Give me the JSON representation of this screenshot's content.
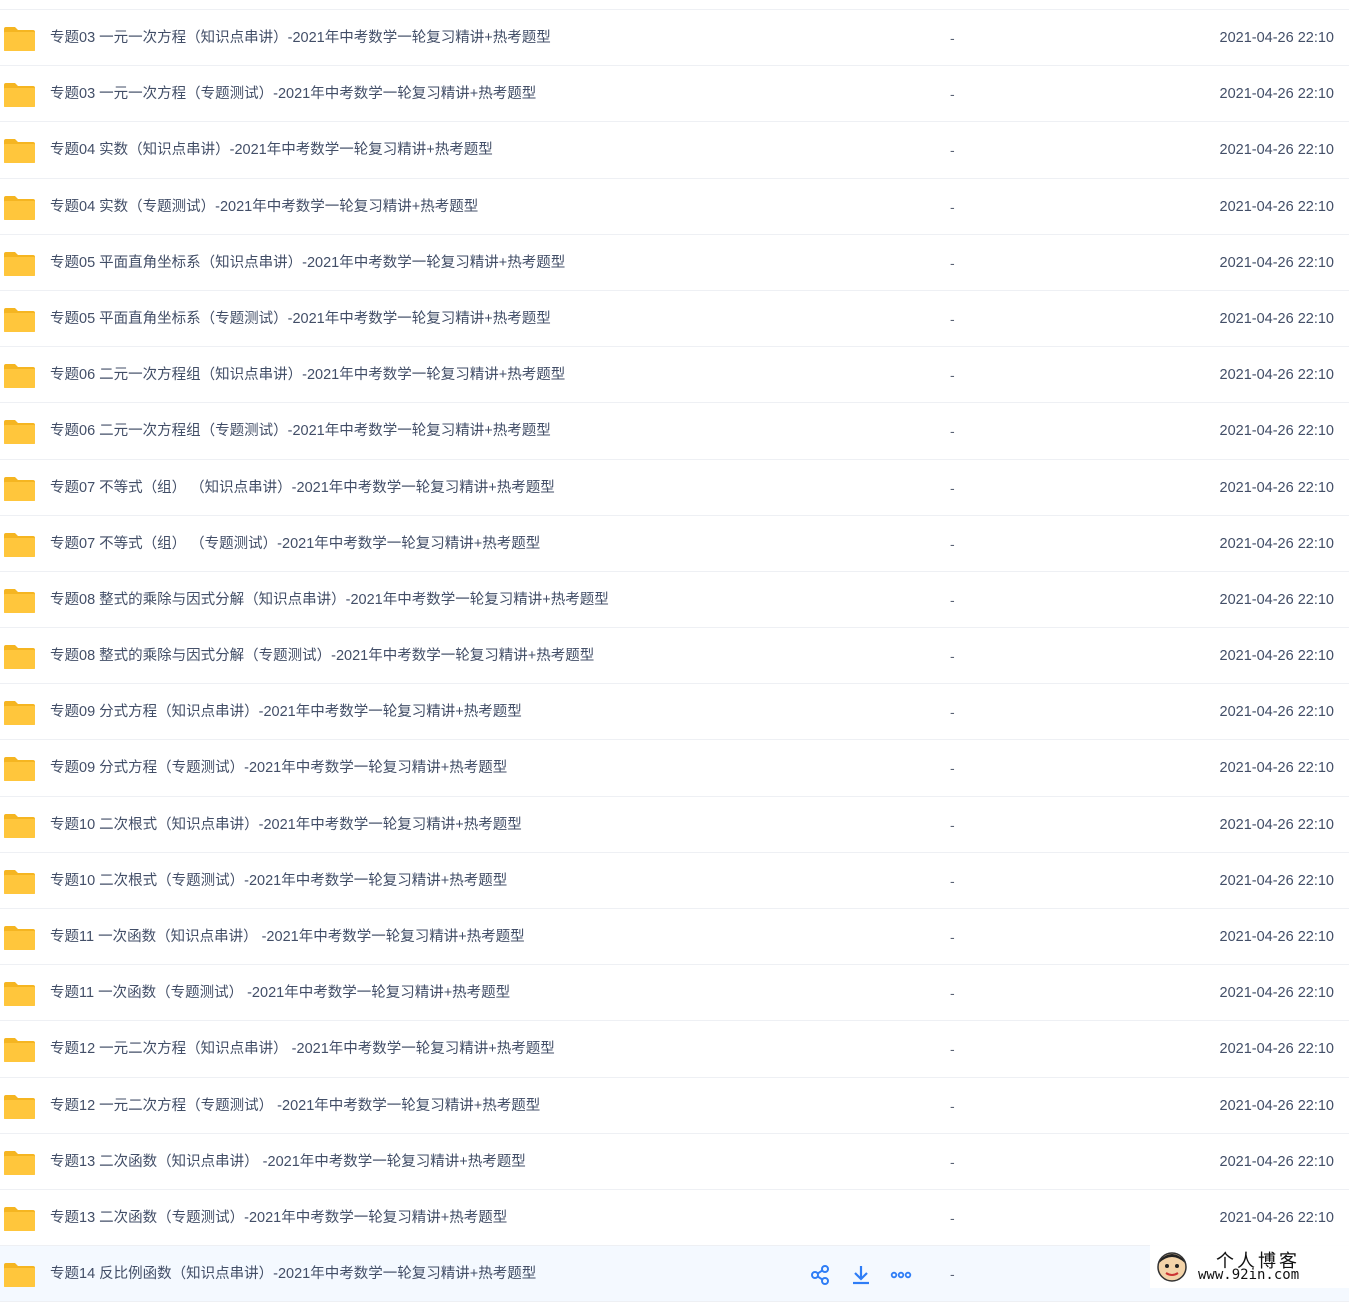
{
  "colors": {
    "folder": "#ffc63c",
    "folder_dark": "#f5b521",
    "action_blue": "#2e7df6",
    "text": "#424e67"
  },
  "file_list": {
    "rows": [
      {
        "name": "专题03 一元一次方程（知识点串讲）-2021年中考数学一轮复习精讲+热考题型",
        "size": "-",
        "date": "2021-04-26 22:10"
      },
      {
        "name": "专题03 一元一次方程（专题测试）-2021年中考数学一轮复习精讲+热考题型",
        "size": "-",
        "date": "2021-04-26 22:10"
      },
      {
        "name": "专题04 实数（知识点串讲）-2021年中考数学一轮复习精讲+热考题型",
        "size": "-",
        "date": "2021-04-26 22:10"
      },
      {
        "name": "专题04 实数（专题测试）-2021年中考数学一轮复习精讲+热考题型",
        "size": "-",
        "date": "2021-04-26 22:10"
      },
      {
        "name": "专题05 平面直角坐标系（知识点串讲）-2021年中考数学一轮复习精讲+热考题型",
        "size": "-",
        "date": "2021-04-26 22:10"
      },
      {
        "name": "专题05 平面直角坐标系（专题测试）-2021年中考数学一轮复习精讲+热考题型",
        "size": "-",
        "date": "2021-04-26 22:10"
      },
      {
        "name": "专题06 二元一次方程组（知识点串讲）-2021年中考数学一轮复习精讲+热考题型",
        "size": "-",
        "date": "2021-04-26 22:10"
      },
      {
        "name": "专题06 二元一次方程组（专题测试）-2021年中考数学一轮复习精讲+热考题型",
        "size": "-",
        "date": "2021-04-26 22:10"
      },
      {
        "name": "专题07 不等式（组） （知识点串讲）-2021年中考数学一轮复习精讲+热考题型",
        "size": "-",
        "date": "2021-04-26 22:10"
      },
      {
        "name": "专题07 不等式（组） （专题测试）-2021年中考数学一轮复习精讲+热考题型",
        "size": "-",
        "date": "2021-04-26 22:10"
      },
      {
        "name": "专题08 整式的乘除与因式分解（知识点串讲）-2021年中考数学一轮复习精讲+热考题型",
        "size": "-",
        "date": "2021-04-26 22:10"
      },
      {
        "name": "专题08 整式的乘除与因式分解（专题测试）-2021年中考数学一轮复习精讲+热考题型",
        "size": "-",
        "date": "2021-04-26 22:10"
      },
      {
        "name": "专题09 分式方程（知识点串讲）-2021年中考数学一轮复习精讲+热考题型",
        "size": "-",
        "date": "2021-04-26 22:10"
      },
      {
        "name": "专题09 分式方程（专题测试）-2021年中考数学一轮复习精讲+热考题型",
        "size": "-",
        "date": "2021-04-26 22:10"
      },
      {
        "name": "专题10 二次根式（知识点串讲）-2021年中考数学一轮复习精讲+热考题型",
        "size": "-",
        "date": "2021-04-26 22:10"
      },
      {
        "name": "专题10 二次根式（专题测试）-2021年中考数学一轮复习精讲+热考题型",
        "size": "-",
        "date": "2021-04-26 22:10"
      },
      {
        "name": "专题11 一次函数（知识点串讲） -2021年中考数学一轮复习精讲+热考题型",
        "size": "-",
        "date": "2021-04-26 22:10"
      },
      {
        "name": "专题11 一次函数（专题测试） -2021年中考数学一轮复习精讲+热考题型",
        "size": "-",
        "date": "2021-04-26 22:10"
      },
      {
        "name": "专题12 一元二次方程（知识点串讲） -2021年中考数学一轮复习精讲+热考题型",
        "size": "-",
        "date": "2021-04-26 22:10"
      },
      {
        "name": "专题12 一元二次方程（专题测试） -2021年中考数学一轮复习精讲+热考题型",
        "size": "-",
        "date": "2021-04-26 22:10"
      },
      {
        "name": "专题13 二次函数（知识点串讲） -2021年中考数学一轮复习精讲+热考题型",
        "size": "-",
        "date": "2021-04-26 22:10"
      },
      {
        "name": "专题13 二次函数（专题测试）-2021年中考数学一轮复习精讲+热考题型",
        "size": "-",
        "date": "2021-04-26 22:10"
      },
      {
        "name": "专题14 反比例函数（知识点串讲）-2021年中考数学一轮复习精讲+热考题型",
        "size": "-",
        "date": "",
        "hovered": true
      }
    ],
    "hover_actions": [
      "share-icon",
      "download-icon",
      "more-icon"
    ]
  },
  "watermark": {
    "title": "个人博客",
    "url": "www.92in.com"
  }
}
